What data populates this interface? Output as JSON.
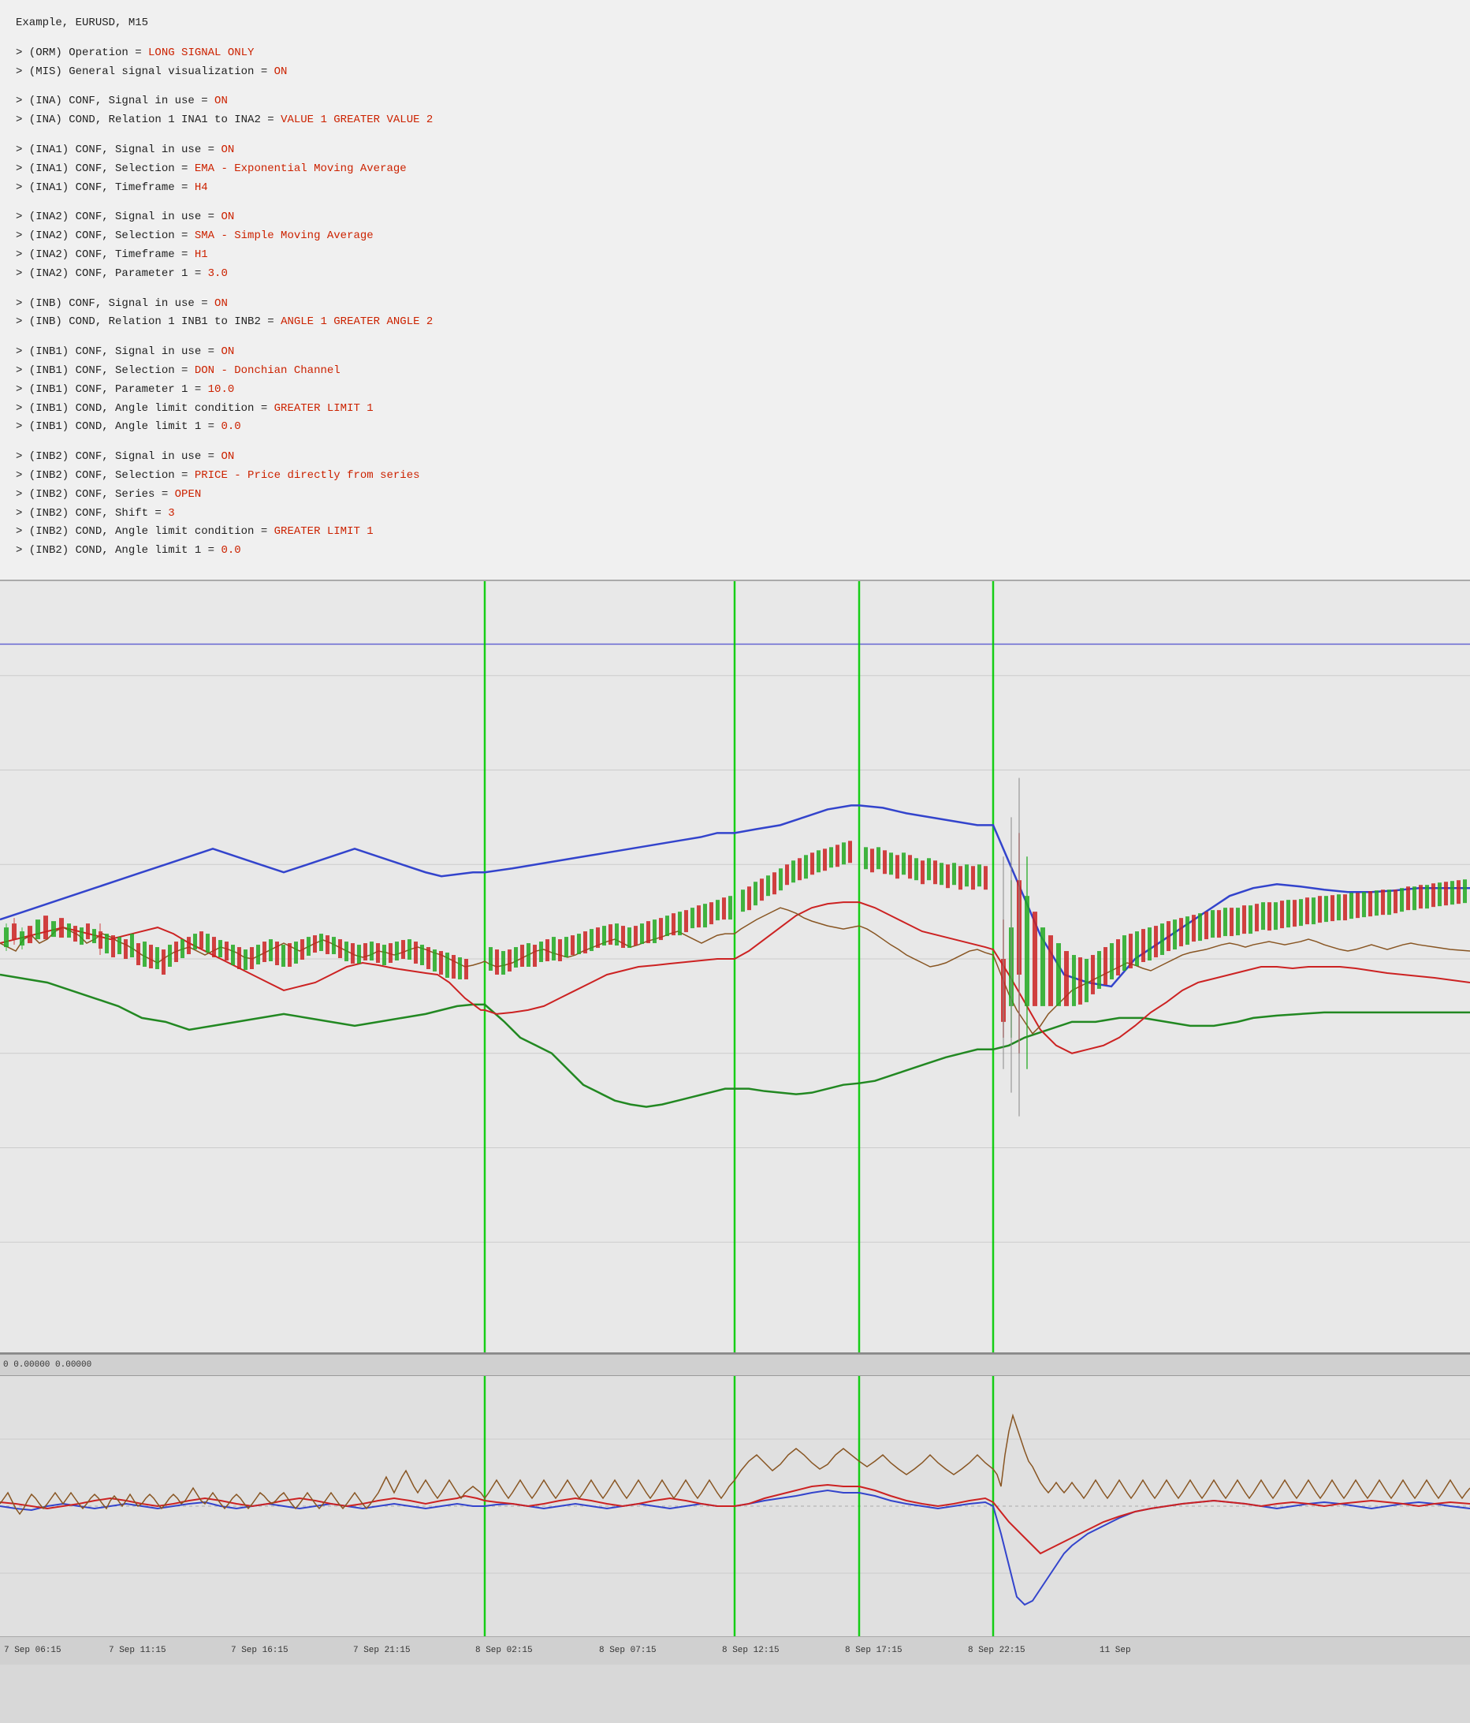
{
  "header": {
    "example": "Example, EURUSD, M15"
  },
  "config_lines": [
    {
      "id": "orm",
      "text": "> (ORM) Operation = ",
      "value": "LONG SIGNAL ONLY",
      "color": "red"
    },
    {
      "id": "mis",
      "text": "> (MIS) General signal visualization = ",
      "value": "ON",
      "color": "red"
    }
  ],
  "ina_group": [
    {
      "id": "ina-conf",
      "text": "> (INA) CONF, Signal in use = ",
      "value": "ON",
      "color": "red"
    },
    {
      "id": "ina-cond",
      "text": "> (INA) COND, Relation 1 INA1 to INA2 = ",
      "value": "VALUE 1 GREATER VALUE 2",
      "color": "red"
    }
  ],
  "ina1_group": [
    {
      "id": "ina1-conf",
      "text": "> (INA1) CONF, Signal in use = ",
      "value": "ON",
      "color": "red"
    },
    {
      "id": "ina1-sel",
      "text": "> (INA1) CONF, Selection = ",
      "value": "EMA - Exponential Moving Average",
      "color": "red"
    },
    {
      "id": "ina1-tf",
      "text": "> (INA1) CONF, Timeframe = ",
      "value": "H4",
      "color": "red"
    }
  ],
  "ina2_group": [
    {
      "id": "ina2-conf",
      "text": "> (INA2) CONF, Signal in use = ",
      "value": "ON",
      "color": "red"
    },
    {
      "id": "ina2-sel",
      "text": "> (INA2) CONF, Selection = ",
      "value": "SMA - Simple Moving Average",
      "color": "red"
    },
    {
      "id": "ina2-tf",
      "text": "> (INA2) CONF, Timeframe = ",
      "value": "H1",
      "color": "red"
    },
    {
      "id": "ina2-p1",
      "text": "> (INA2) CONF, Parameter 1 = ",
      "value": "3.0",
      "color": "red"
    }
  ],
  "inb_group": [
    {
      "id": "inb-conf",
      "text": "> (INB) CONF, Signal in use = ",
      "value": "ON",
      "color": "red"
    },
    {
      "id": "inb-cond",
      "text": "> (INB) COND, Relation 1 INB1 to INB2 = ",
      "value": "ANGLE 1 GREATER ANGLE 2",
      "color": "red"
    }
  ],
  "inb1_group": [
    {
      "id": "inb1-conf",
      "text": "> (INB1) CONF, Signal in use = ",
      "value": "ON",
      "color": "red"
    },
    {
      "id": "inb1-sel",
      "text": "> (INB1) CONF, Selection = ",
      "value": "DON - Donchian Channel",
      "color": "red"
    },
    {
      "id": "inb1-p1",
      "text": "> (INB1) CONF, Parameter 1 = ",
      "value": "10.0",
      "color": "red"
    },
    {
      "id": "inb1-angle-cond",
      "text": "> (INB1) COND, Angle limit condition = ",
      "value": "GREATER LIMIT 1",
      "color": "red"
    },
    {
      "id": "inb1-angle-lim",
      "text": "> (INB1) COND, Angle limit 1 = ",
      "value": "0.0",
      "color": "red"
    }
  ],
  "inb2_group": [
    {
      "id": "inb2-conf",
      "text": "> (INB2) CONF, Signal in use = ",
      "value": "ON",
      "color": "red"
    },
    {
      "id": "inb2-sel",
      "text": "> (INB2) CONF, Selection = ",
      "value": "PRICE - Price directly from series",
      "color": "red"
    },
    {
      "id": "inb2-series",
      "text": "> (INB2) CONF, Series = ",
      "value": "OPEN",
      "color": "red"
    },
    {
      "id": "inb2-shift",
      "text": "> (INB2) CONF, Shift = ",
      "value": "3",
      "color": "red"
    },
    {
      "id": "inb2-angle-cond",
      "text": "> (INB2) COND, Angle limit condition = ",
      "value": "GREATER LIMIT 1",
      "color": "red"
    },
    {
      "id": "inb2-angle-lim",
      "text": "> (INB2) COND, Angle limit 1 = ",
      "value": "0.0",
      "color": "red"
    }
  ],
  "zero_line": "0 0.00000 0.00000",
  "time_labels": [
    {
      "id": "t1",
      "label": "7 Sep 06:15",
      "left_pct": 0.5
    },
    {
      "id": "t2",
      "label": "7 Sep 11:15",
      "left_pct": 7.5
    },
    {
      "id": "t3",
      "label": "7 Sep 16:15",
      "left_pct": 16
    },
    {
      "id": "t4",
      "label": "7 Sep 21:15",
      "left_pct": 24.5
    },
    {
      "id": "t5",
      "label": "8 Sep 02:15",
      "left_pct": 33
    },
    {
      "id": "t6",
      "label": "8 Sep 07:15",
      "left_pct": 41.5
    },
    {
      "id": "t7",
      "label": "8 Sep 12:15",
      "left_pct": 50
    },
    {
      "id": "t8",
      "label": "8 Sep 17:15",
      "left_pct": 58.5
    },
    {
      "id": "t9",
      "label": "8 Sep 22:15",
      "left_pct": 67
    },
    {
      "id": "t10",
      "label": "11 Sep",
      "left_pct": 75.5
    }
  ],
  "green_lines": [
    33,
    50,
    58.5,
    67.5
  ],
  "chart_colors": {
    "blue": "#3344cc",
    "green": "#228822",
    "red": "#cc2222",
    "brown": "#885522",
    "candle_green": "#22aa22",
    "candle_red": "#cc2222"
  }
}
